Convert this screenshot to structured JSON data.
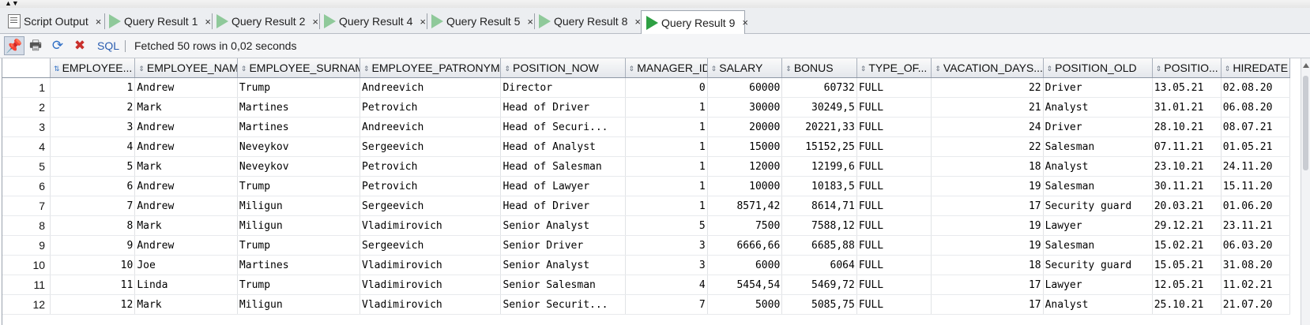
{
  "tabs": [
    {
      "label": "Script Output",
      "icon": "script-icon"
    },
    {
      "label": "Query Result 1",
      "icon": "run-icon"
    },
    {
      "label": "Query Result 2",
      "icon": "run-icon"
    },
    {
      "label": "Query Result 4",
      "icon": "run-icon"
    },
    {
      "label": "Query Result 5",
      "icon": "run-icon"
    },
    {
      "label": "Query Result 8",
      "icon": "run-icon"
    },
    {
      "label": "Query Result 9",
      "icon": "run-icon",
      "active": true
    }
  ],
  "tab_close": "×",
  "toolbar": {
    "sql_label": "SQL",
    "status": "Fetched 50 rows in 0,02 seconds"
  },
  "columns": [
    "EMPLOYEE...",
    "EMPLOYEE_NAME",
    "EMPLOYEE_SURNAME",
    "EMPLOYEE_PATRONYMIC",
    "POSITION_NOW",
    "MANAGER_ID",
    "SALARY",
    "BONUS",
    "TYPE_OF...",
    "VACATION_DAYS...",
    "POSITION_OLD",
    "POSITIO...",
    "HIREDATE"
  ],
  "rows": [
    [
      "1",
      "1",
      "Andrew",
      "Trump",
      "Andreevich",
      "Director",
      "0",
      "60000",
      "60732",
      "FULL",
      "22",
      "Driver",
      "13.05.21",
      "02.08.20"
    ],
    [
      "2",
      "2",
      "Mark",
      "Martines",
      "Petrovich",
      "Head of Driver",
      "1",
      "30000",
      "30249,5",
      "FULL",
      "21",
      "Analyst",
      "31.01.21",
      "06.08.20"
    ],
    [
      "3",
      "3",
      "Andrew",
      "Martines",
      "Andreevich",
      "Head of Securi...",
      "1",
      "20000",
      "20221,33",
      "FULL",
      "24",
      "Driver",
      "28.10.21",
      "08.07.21"
    ],
    [
      "4",
      "4",
      "Andrew",
      "Neveykov",
      "Sergeevich",
      "Head of Analyst",
      "1",
      "15000",
      "15152,25",
      "FULL",
      "22",
      "Salesman",
      "07.11.21",
      "01.05.21"
    ],
    [
      "5",
      "5",
      "Mark",
      "Neveykov",
      "Petrovich",
      "Head of Salesman",
      "1",
      "12000",
      "12199,6",
      "FULL",
      "18",
      "Analyst",
      "23.10.21",
      "24.11.20"
    ],
    [
      "6",
      "6",
      "Andrew",
      "Trump",
      "Petrovich",
      "Head of Lawyer",
      "1",
      "10000",
      "10183,5",
      "FULL",
      "19",
      "Salesman",
      "30.11.21",
      "15.11.20"
    ],
    [
      "7",
      "7",
      "Andrew",
      "Miligun",
      "Sergeevich",
      "Head of Driver",
      "1",
      "8571,42",
      "8614,71",
      "FULL",
      "17",
      "Security guard",
      "20.03.21",
      "01.06.20"
    ],
    [
      "8",
      "8",
      "Mark",
      "Miligun",
      "Vladimirovich",
      "Senior Analyst",
      "5",
      "7500",
      "7588,12",
      "FULL",
      "19",
      "Lawyer",
      "29.12.21",
      "23.11.21"
    ],
    [
      "9",
      "9",
      "Andrew",
      "Trump",
      "Sergeevich",
      "Senior Driver",
      "3",
      "6666,66",
      "6685,88",
      "FULL",
      "19",
      "Salesman",
      "15.02.21",
      "06.03.20"
    ],
    [
      "10",
      "10",
      "Joe",
      "Martines",
      "Vladimirovich",
      "Senior Analyst",
      "3",
      "6000",
      "6064",
      "FULL",
      "18",
      "Security guard",
      "15.05.21",
      "31.08.20"
    ],
    [
      "11",
      "11",
      "Linda",
      "Trump",
      "Vladimirovich",
      "Senior Salesman",
      "4",
      "5454,54",
      "5469,72",
      "FULL",
      "17",
      "Lawyer",
      "12.05.21",
      "11.02.21"
    ],
    [
      "12",
      "12",
      "Mark",
      "Miligun",
      "Vladimirovich",
      "Senior Securit...",
      "7",
      "5000",
      "5085,75",
      "FULL",
      "17",
      "Analyst",
      "25.10.21",
      "21.07.20"
    ]
  ]
}
